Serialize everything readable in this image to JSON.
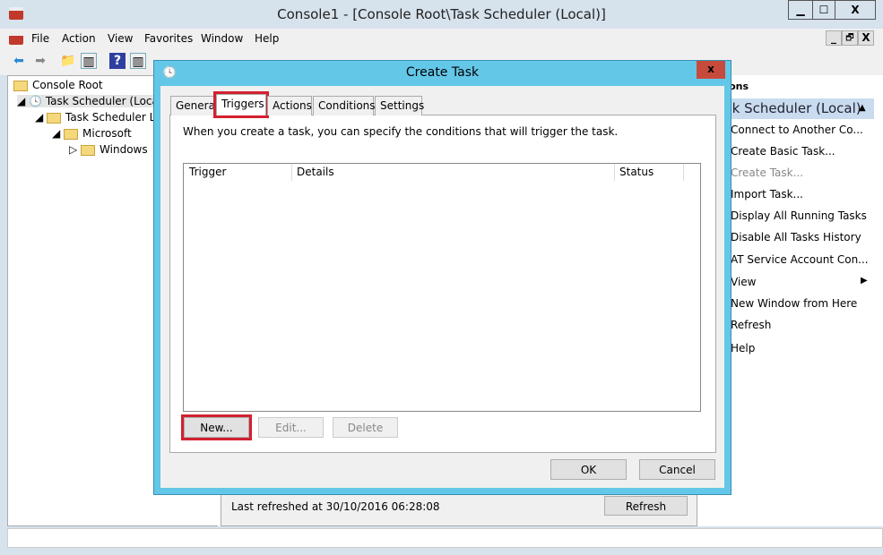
{
  "window": {
    "title": "Console1 - [Console Root\\Task Scheduler (Local)]",
    "min": "▁",
    "max": "☐",
    "close": "X",
    "child_min": "_",
    "child_restore": "🗗",
    "child_close": "X"
  },
  "menu": [
    "File",
    "Action",
    "View",
    "Favorites",
    "Window",
    "Help"
  ],
  "tree": {
    "root": "Console Root",
    "scheduler": "Task Scheduler (Local)",
    "library": "Task Scheduler Library",
    "microsoft": "Microsoft",
    "windows": "Windows"
  },
  "center": {
    "last_refreshed": "Last refreshed at 30/10/2016 06:28:08",
    "refresh": "Refresh"
  },
  "actions": {
    "header": "Actions",
    "section": "Task Scheduler (Local)",
    "items": [
      "Connect to Another Co...",
      "Create Basic Task...",
      "Create Task...",
      "Import Task...",
      "Display All Running Tasks",
      "Disable All Tasks History",
      "AT Service Account Con...",
      "View",
      "New Window from Here",
      "Refresh",
      "Help"
    ]
  },
  "dialog": {
    "title": "Create Task",
    "close": "x",
    "tabs": [
      "General",
      "Triggers",
      "Actions",
      "Conditions",
      "Settings"
    ],
    "active_tab": "Triggers",
    "description": "When you create a task, you can specify the conditions that will trigger the task.",
    "columns": [
      "Trigger",
      "Details",
      "Status"
    ],
    "new": "New...",
    "edit": "Edit...",
    "delete": "Delete",
    "ok": "OK",
    "cancel": "Cancel"
  },
  "colors": {
    "dialog_frame": "#63c7e8",
    "highlight": "#d32030",
    "close_button": "#c74b3c"
  }
}
